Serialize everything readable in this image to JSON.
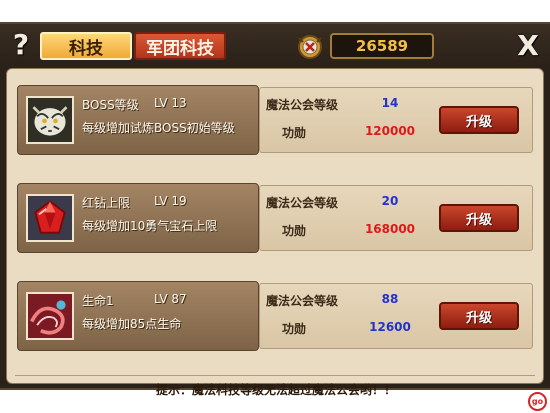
{
  "topbar": {
    "help_glyph": "?",
    "tabs": [
      {
        "label": "科技",
        "active": true
      },
      {
        "label": "军团科技",
        "active": false
      }
    ],
    "gold_icon": "gold-emblem-icon",
    "gold_value": "26589",
    "close_glyph": "X"
  },
  "rows": [
    {
      "icon": "white-tiger-icon",
      "name": "BOSS等级",
      "level": "LV  13",
      "description": "每级增加试炼BOSS初始等级",
      "req_label": "魔法公会等级",
      "req_value": "14",
      "merit_label": "功勋",
      "merit_value": "120000",
      "merit_color": "#e01818",
      "button": "升级"
    },
    {
      "icon": "red-gem-icon",
      "name": "红钻上限",
      "level": "LV  19",
      "description": "每级增加10勇气宝石上限",
      "req_label": "魔法公会等级",
      "req_value": "20",
      "merit_label": "功勋",
      "merit_value": "168000",
      "merit_color": "#e01818",
      "button": "升级"
    },
    {
      "icon": "life-swirl-icon",
      "name": "生命1",
      "level": "LV  87",
      "description": "每级增加85点生命",
      "req_label": "魔法公会等级",
      "req_value": "88",
      "merit_label": "功勋",
      "merit_value": "12600",
      "merit_color": "#2233cc",
      "button": "升级"
    }
  ],
  "hint": "提示：魔法科技等级无法超过魔法公会哟！！",
  "watermark": "go",
  "colors": {
    "frame": "#2a2119",
    "panel": "#e9dcc3",
    "tab_active": "#f0a935",
    "tab_inactive": "#b3341c",
    "gold_text": "#f3c042",
    "button": "#b33520"
  }
}
